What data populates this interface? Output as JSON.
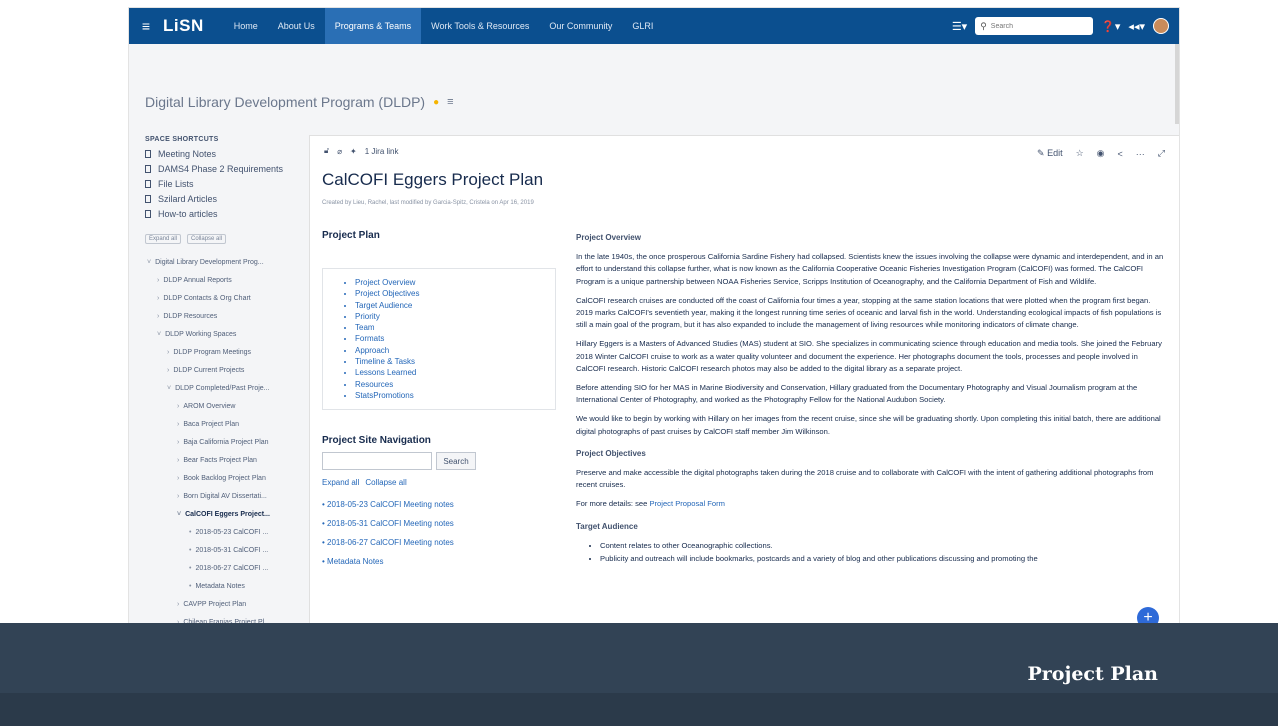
{
  "nav": {
    "logo": "LiSN",
    "items": [
      "Home",
      "About Us",
      "Programs & Teams",
      "Work Tools & Resources",
      "Our Community",
      "GLRI"
    ],
    "active": "Programs & Teams",
    "search_placeholder": "Search"
  },
  "space": {
    "title": "Digital Library Development Program (DLDP)"
  },
  "sidebar": {
    "shortcuts_heading": "SPACE SHORTCUTS",
    "shortcuts": [
      "Meeting Notes",
      "DAMS4 Phase 2 Requirements",
      "File Lists",
      "Szilard Articles",
      "How-to articles"
    ],
    "expand_all": "Expand all",
    "collapse_all": "Collapse all",
    "tree": [
      "Digital Library Development Prog...",
      "DLDP Annual Reports",
      "DLDP Contacts & Org Chart",
      "DLDP Resources",
      "DLDP Working Spaces",
      "DLDP Program Meetings",
      "DLDP Current Projects",
      "DLDP Completed/Past Proje...",
      "AROM Overview",
      "Baca Project Plan",
      "Baja California Project Plan",
      "Bear Facts Project Plan",
      "Book Backlog Project Plan",
      "Born Digital AV Dissertati...",
      "CalCOFI Eggers Project...",
      "2018-05-23 CalCOFI ...",
      "2018-05-31 CalCOFI ...",
      "2018-06-27 CalCOFI ...",
      "Metadata Notes",
      "CAVPP Project Plan",
      "Chilean Franias Project Pl..."
    ]
  },
  "page": {
    "jira_link": "1 Jira link",
    "edit_label": "Edit",
    "title": "CalCOFI Eggers Project Plan",
    "byline": "Created by Lieu, Rachel, last modified by Garcia-Spitz, Cristela on Apr 16, 2019",
    "left_heading": "Project Plan",
    "toc": [
      "Project Overview",
      "Project Objectives",
      "Target Audience",
      "Priority",
      "Team",
      "Formats",
      "Approach",
      "Timeline & Tasks",
      "Lessons Learned",
      "Resources",
      "StatsPromotions"
    ],
    "site_nav_heading": "Project Site Navigation",
    "search_button": "Search",
    "expand_all": "Expand all",
    "collapse_all": "Collapse all",
    "nav_links": [
      "2018-05-23 CalCOFI Meeting notes",
      "2018-05-31 CalCOFI Meeting notes",
      "2018-06-27 CalCOFI Meeting notes",
      "Metadata Notes"
    ],
    "overview_heading": "Project Overview",
    "overview_p1": "In the late 1940s, the once prosperous California Sardine Fishery had collapsed. Scientists knew the issues involving the collapse were dynamic and interdependent, and in an effort to understand this collapse further, what is now known as the California Cooperative Oceanic Fisheries Investigation Program (CalCOFI) was formed. The CalCOFI Program is a unique partnership between NOAA Fisheries Service, Scripps Institution of Oceanography, and the California Department of Fish and Wildlife.",
    "overview_p2": "CalCOFI research cruises are conducted off the coast of California four times a year, stopping at the same station locations that were plotted when the program first began. 2019 marks CalCOFI's seventieth year, making it the longest running time series of oceanic and larval fish in the world. Understanding ecological impacts of fish populations is still a main goal of the program, but it has also expanded to include the management of living resources while monitoring indicators of climate change.",
    "overview_p3": "Hillary Eggers is a Masters of Advanced Studies (MAS) student at SIO. She specializes in communicating science through education and media tools. She joined the February 2018 Winter CalCOFI cruise to work as a water quality volunteer and document the experience. Her photographs document the tools, processes and people involved in CalCOFI research. Historic CalCOFI research photos may also be added to the digital library as a separate project.",
    "overview_p4": "Before attending SIO for her MAS in Marine Biodiversity and Conservation, Hillary graduated from the Documentary Photography and Visual Journalism program at the International Center of Photography, and worked as the Photography Fellow for the National Audubon Society.",
    "overview_p5": "We would like to begin by working with Hillary on her images from the recent cruise, since she will be graduating shortly.  Upon completing this initial batch, there are additional digital photographs of past cruises by CalCOFI staff member Jim Wilkinson.",
    "objectives_heading": "Project Objectives",
    "objectives_p1": "Preserve and make accessible the digital photographs taken during the 2018 cruise and to collaborate with CalCOFI with the intent of gathering additional photographs from recent cruises.",
    "objectives_more": "For more details: see",
    "objectives_link": "Project Proposal Form",
    "audience_heading": "Target Audience",
    "audience_items": [
      "Content relates to other Oceanographic collections.",
      "Publicity and outreach will include bookmarks, postcards and a variety of blog and other publications discussing and promoting the"
    ]
  },
  "banner": {
    "title": "Project Plan"
  },
  "colors": {
    "nav": "#0b4f8f",
    "nav_active": "#2a6fb5",
    "link": "#2467b8",
    "banner": "#2b3a4a",
    "fab": "#2e6ad8"
  }
}
